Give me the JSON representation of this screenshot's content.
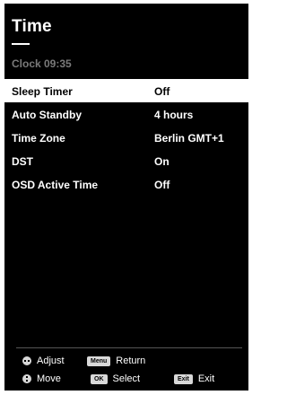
{
  "screen": {
    "title": "Time",
    "clock": "Clock 09:35"
  },
  "menu": {
    "items": [
      {
        "label": "Sleep Timer",
        "value": "Off",
        "selected": true
      },
      {
        "label": "Auto Standby",
        "value": "4 hours",
        "selected": false
      },
      {
        "label": "Time Zone",
        "value": "Berlin GMT+1",
        "selected": false
      },
      {
        "label": "DST",
        "value": "On",
        "selected": false
      },
      {
        "label": "OSD Active Time",
        "value": "Off",
        "selected": false
      }
    ]
  },
  "footer": {
    "adjust_label": "Adjust",
    "menu_key": "Menu",
    "return_label": "Return",
    "move_label": "Move",
    "ok_key": "OK",
    "select_label": "Select",
    "exit_key": "Exit",
    "exit_label": "Exit"
  },
  "colors": {
    "background": "#000000",
    "highlight": "#ffffff",
    "muted_text": "#7a7a7a"
  }
}
